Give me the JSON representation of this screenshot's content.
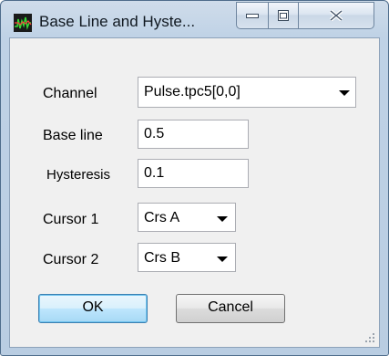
{
  "window": {
    "title": "Base Line and Hyste...",
    "controls": [
      "minimize-icon",
      "maximize-icon",
      "close-icon"
    ]
  },
  "form": {
    "channel_label": "Channel",
    "channel_value": "Pulse.tpc5[0,0]",
    "baseline_label": "Base line",
    "baseline_value": "0.5",
    "hysteresis_label": "Hysteresis",
    "hysteresis_value": "0.1",
    "cursor1_label": "Cursor 1",
    "cursor1_value": "Crs A",
    "cursor2_label": "Cursor 2",
    "cursor2_value": "Crs B"
  },
  "buttons": {
    "ok_label": "OK",
    "cancel_label": "Cancel"
  },
  "colors": {
    "default_button_border": "#3c7fb1",
    "frame": "#bfd2e6",
    "client": "#f0f0f0"
  }
}
